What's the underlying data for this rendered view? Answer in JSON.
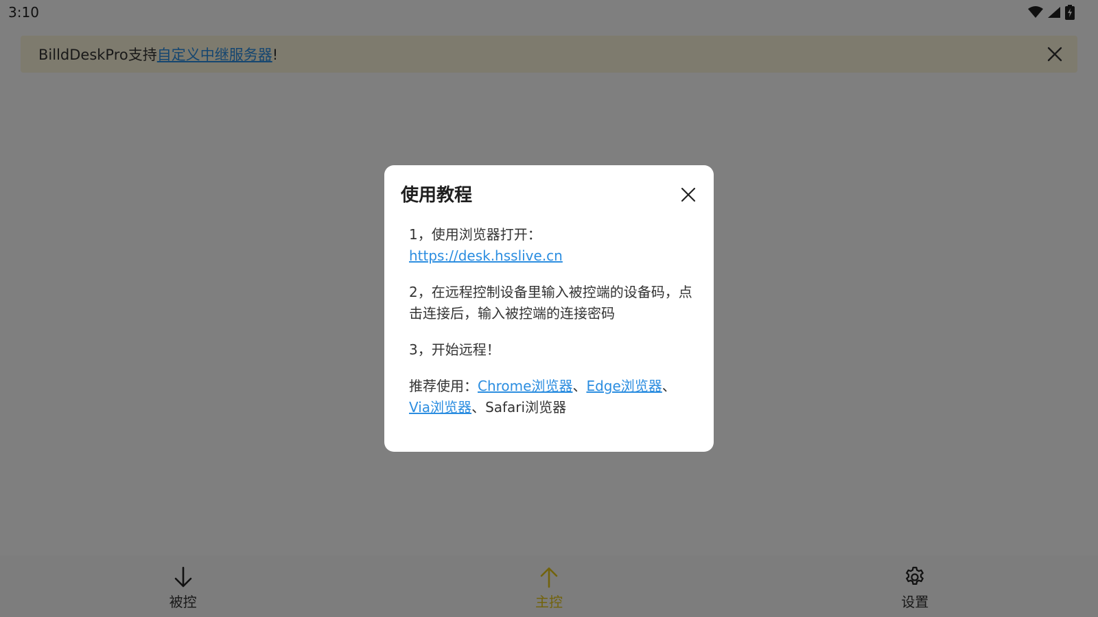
{
  "status_bar": {
    "time": "3:10"
  },
  "notice": {
    "text_prefix": "BilldDeskPro支持",
    "link_text": "自定义中继服务器",
    "text_suffix": "!"
  },
  "nav": {
    "items": [
      {
        "label": "被控",
        "icon": "arrow-down-icon",
        "active": false
      },
      {
        "label": "主控",
        "icon": "arrow-up-icon",
        "active": true
      },
      {
        "label": "设置",
        "icon": "gear-icon",
        "active": false
      }
    ]
  },
  "dialog": {
    "title": "使用教程",
    "step1_text": "1，使用浏览器打开：",
    "step1_link": "https://desk.hsslive.cn",
    "step2_text": "2，在远程控制设备里输入被控端的设备码，点击连接后，输入被控端的连接密码",
    "step3_text": "3，开始远程！",
    "recommend_label": "推荐使用：",
    "browser_chrome": "Chrome浏览器",
    "browser_edge": "Edge浏览器",
    "browser_via": "Via浏览器",
    "browser_safari": "Safari浏览器",
    "separator": "、"
  },
  "colors": {
    "accent": "#e5c619",
    "link": "#2b8de0",
    "notice_bg": "#fdf6dc",
    "overlay": "#000000"
  }
}
